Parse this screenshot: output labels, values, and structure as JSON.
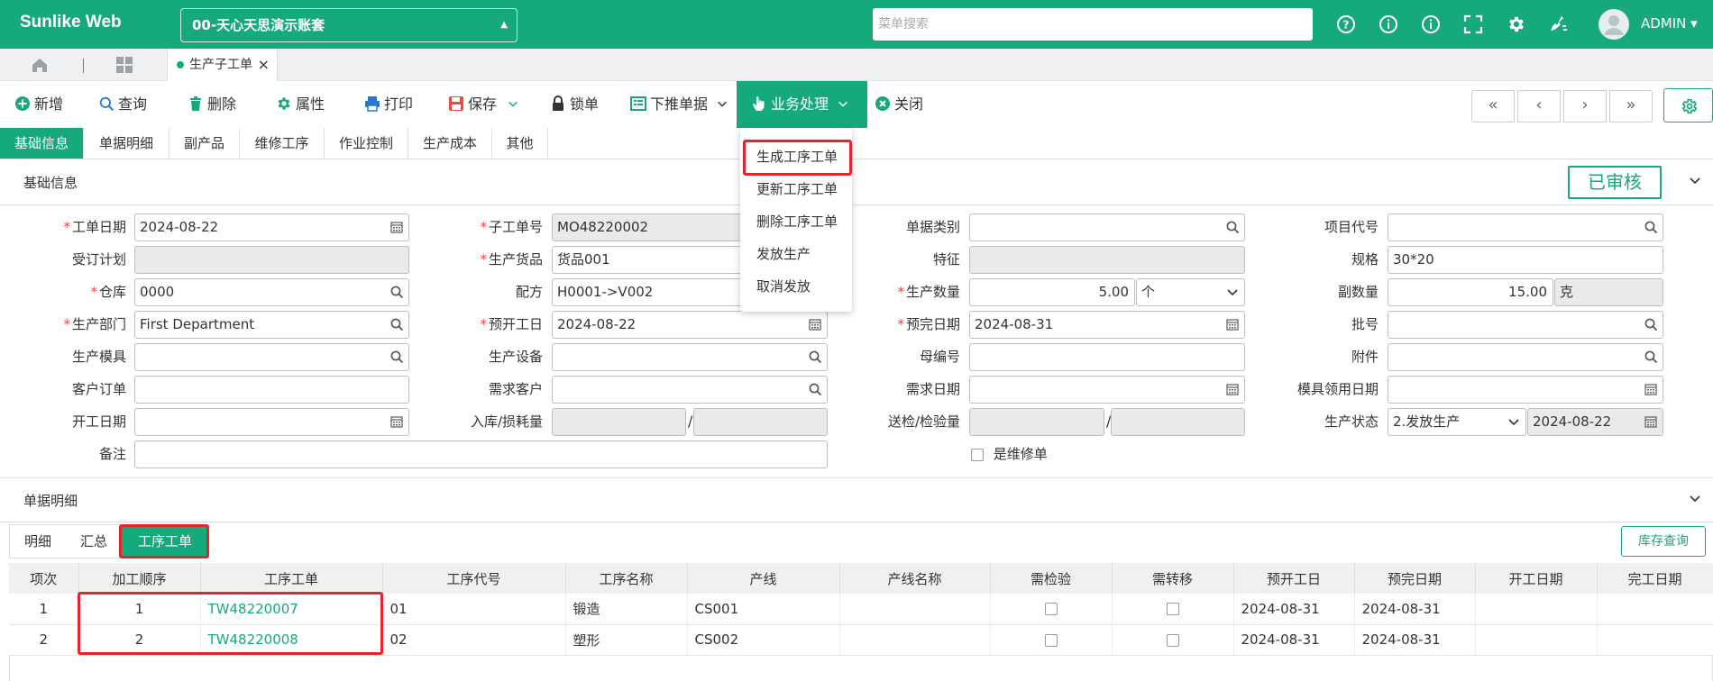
{
  "header": {
    "brand": "Sunlike Web",
    "account": "00-天心天思演示账套",
    "search_placeholder": "菜单搜索",
    "user": "ADMIN"
  },
  "tabs": {
    "active": "生产子工单"
  },
  "toolbar": {
    "add": "新增",
    "query": "查询",
    "delete": "删除",
    "properties": "属性",
    "print": "打印",
    "save": "保存",
    "lock": "锁单",
    "push_down": "下推单据",
    "business": "业务处理",
    "close": "关闭"
  },
  "section_tabs": [
    "基础信息",
    "单据明细",
    "副产品",
    "维修工序",
    "作业控制",
    "生产成本",
    "其他"
  ],
  "basic_section": {
    "title": "基础信息",
    "status": "已审核"
  },
  "dropdown": [
    "生成工序工单",
    "更新工序工单",
    "删除工序工单",
    "发放生产",
    "取消发放"
  ],
  "form": {
    "work_date_label": "工单日期",
    "work_date": "2024-08-22",
    "sub_order_label": "子工单号",
    "sub_order": "MO48220002",
    "doc_type_label": "单据类别",
    "doc_type": "",
    "project_label": "项目代号",
    "project": "",
    "plan_label": "受订计划",
    "plan": "",
    "product_label": "生产货品",
    "product": "货品001",
    "feature_label": "特征",
    "feature": "",
    "spec_label": "规格",
    "spec": "30*20",
    "warehouse_label": "仓库",
    "warehouse": "0000",
    "formula_label": "配方",
    "formula": "H0001->V002",
    "qty_label": "生产数量",
    "qty": "5.00",
    "qty_unit": "个",
    "sub_qty_label": "副数量",
    "sub_qty": "15.00",
    "sub_unit": "克",
    "dept_label": "生产部门",
    "dept": "First Department",
    "plan_start_label": "预开工日",
    "plan_start": "2024-08-22",
    "plan_end_label": "预完日期",
    "plan_end": "2024-08-31",
    "batch_label": "批号",
    "batch": "",
    "mold_label": "生产模具",
    "mold": "",
    "equip_label": "生产设备",
    "equip": "",
    "parent_label": "母编号",
    "parent": "",
    "attach_label": "附件",
    "attach": "",
    "cust_order_label": "客户订单",
    "cust_order": "",
    "cust_label": "需求客户",
    "cust": "",
    "need_date_label": "需求日期",
    "need_date": "",
    "mold_date_label": "模具领用日期",
    "mold_date": "",
    "start_date_label": "开工日期",
    "start_date": "",
    "inbound_label": "入库/损耗量",
    "inbound_a": "",
    "inbound_b": "",
    "inspect_label": "送检/检验量",
    "inspect_a": "",
    "inspect_b": "",
    "prod_status_label": "生产状态",
    "prod_status": "2.发放生产",
    "prod_status_date": "2024-08-22",
    "remark_label": "备注",
    "remark": "",
    "repair_label": "是维修单"
  },
  "detail_section": {
    "title": "单据明细",
    "subtabs": [
      "明细",
      "汇总",
      "工序工单"
    ],
    "stock_query": "库存查询"
  },
  "grid": {
    "columns": [
      "项次",
      "加工顺序",
      "工序工单",
      "工序代号",
      "工序名称",
      "产线",
      "产线名称",
      "需检验",
      "需转移",
      "预开工日",
      "预完日期",
      "开工日期",
      "完工日期"
    ],
    "rows": [
      {
        "idx": "1",
        "seq": "1",
        "order": "TW48220007",
        "code": "01",
        "name": "锻造",
        "line": "CS001",
        "line_name": "",
        "plan_start": "2024-08-31",
        "plan_end": "2024-08-31",
        "start": "",
        "end": ""
      },
      {
        "idx": "2",
        "seq": "2",
        "order": "TW48220008",
        "code": "02",
        "name": "塑形",
        "line": "CS002",
        "line_name": "",
        "plan_start": "2024-08-31",
        "plan_end": "2024-08-31",
        "start": "",
        "end": ""
      }
    ]
  },
  "colors": {
    "primary": "#16a97c",
    "highlight": "#e3262a"
  },
  "icons": [
    "help-icon",
    "info-icon",
    "fullscreen-icon",
    "gear-icon",
    "clean-icon",
    "home-icon",
    "grid-icon",
    "plus-icon",
    "search-icon",
    "trash-icon",
    "printer-icon",
    "save-icon",
    "lock-icon",
    "hand-pointer-icon",
    "close-icon",
    "calendar-icon",
    "chevron-down-icon"
  ]
}
